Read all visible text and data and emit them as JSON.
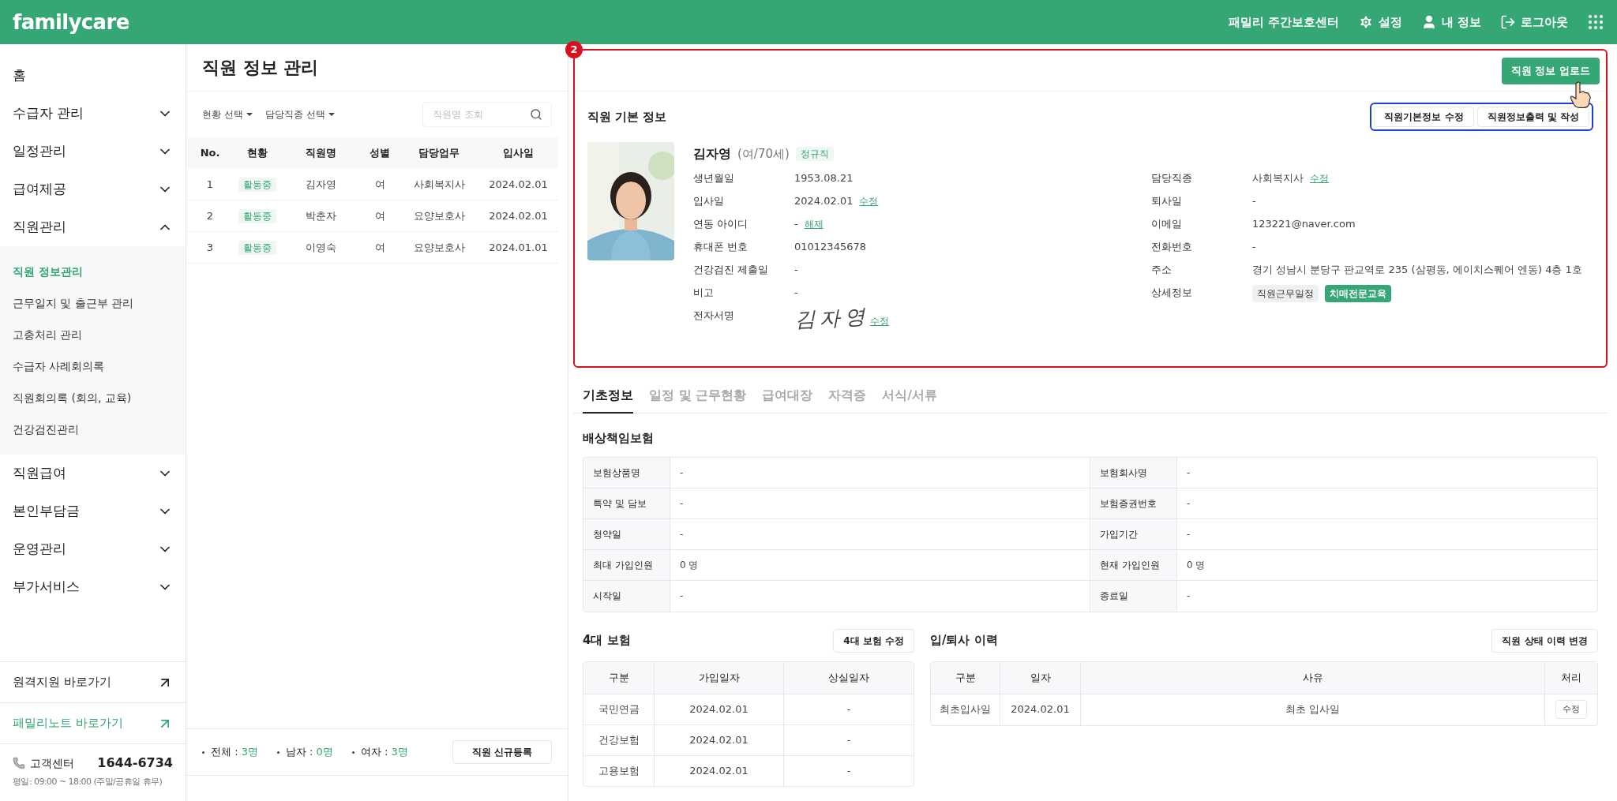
{
  "header": {
    "logo": "familycare",
    "center_name": "패밀리 주간보호센터",
    "links": [
      {
        "kind": "settings",
        "label": "설정"
      },
      {
        "kind": "profile",
        "label": "내 정보"
      },
      {
        "kind": "logout",
        "label": "로그아웃"
      }
    ]
  },
  "sidebar": {
    "items": [
      {
        "kind": "link",
        "label": "홈"
      },
      {
        "kind": "group",
        "label": "수급자 관리",
        "expanded": false
      },
      {
        "kind": "group",
        "label": "일정관리",
        "expanded": false
      },
      {
        "kind": "group",
        "label": "급여제공",
        "expanded": false
      },
      {
        "kind": "group",
        "label": "직원관리",
        "expanded": true,
        "children": [
          {
            "label": "직원 정보관리",
            "selected": true
          },
          {
            "label": "근무일지 및 출근부 관리",
            "selected": false
          },
          {
            "label": "고충처리 관리",
            "selected": false
          },
          {
            "label": "수급자 사례회의록",
            "selected": false
          },
          {
            "label": "직원회의록 (회의, 교육)",
            "selected": false
          },
          {
            "label": "건강검진관리",
            "selected": false
          }
        ]
      },
      {
        "kind": "group",
        "label": "직원급여",
        "expanded": false
      },
      {
        "kind": "group",
        "label": "본인부담금",
        "expanded": false
      },
      {
        "kind": "group",
        "label": "운영관리",
        "expanded": false
      },
      {
        "kind": "group",
        "label": "부가서비스",
        "expanded": false
      }
    ],
    "shortcuts": [
      {
        "label": "원격지원 바로가기",
        "highlight": false
      },
      {
        "label": "패밀리노트 바로가기",
        "highlight": true
      }
    ],
    "support": {
      "label": "고객센터",
      "phone": "1644-6734",
      "hours": "평일: 09:00 ~ 18:00 (주말/공휴일 휴무)"
    }
  },
  "staff_list": {
    "title": "직원 정보 관리",
    "filters": [
      "현황 선택",
      "담당직종 선택"
    ],
    "search": {
      "placeholder": "직원명 조회"
    },
    "columns": [
      "No.",
      "현황",
      "직원명",
      "성별",
      "담당업무",
      "입사일"
    ],
    "rows": [
      [
        "1",
        "활동중",
        "김자영",
        "여",
        "사회복지사",
        "2024.02.01"
      ],
      [
        "2",
        "활동중",
        "박춘자",
        "여",
        "요양보호사",
        "2024.02.01"
      ],
      [
        "3",
        "활동중",
        "이영숙",
        "여",
        "요양보호사",
        "2024.01.01"
      ]
    ],
    "stats": [
      {
        "label": "전체 :",
        "value": "3명"
      },
      {
        "label": "남자 :",
        "value": "0명"
      },
      {
        "label": "여자 :",
        "value": "3명"
      }
    ],
    "register_button": "직원 신규등록"
  },
  "annotation": {
    "badge": "2"
  },
  "detail": {
    "upload_button": "직원 정보 업로드",
    "section_title": "직원 기본 정보",
    "action_buttons": [
      "직원기본정보 수정",
      "직원정보출력 및 작성"
    ],
    "profile": {
      "name": "김자영",
      "meta": "(여/70세)",
      "employment": "정규직"
    },
    "left_fields": [
      {
        "kind": "text",
        "label": "생년월일",
        "value": "1953.08.21"
      },
      {
        "kind": "text",
        "label": "입사일",
        "value": "2024.02.01",
        "link": "수정"
      },
      {
        "kind": "text",
        "label": "연동 아이디",
        "value": "-",
        "link": "해제"
      },
      {
        "kind": "text",
        "label": "휴대폰 번호",
        "value": "01012345678"
      },
      {
        "kind": "text",
        "label": "건강검진 제출일",
        "value": "-"
      },
      {
        "kind": "text",
        "label": "비고",
        "value": "-"
      },
      {
        "kind": "signature",
        "label": "전자서명",
        "value": "김자영",
        "link": "수정"
      }
    ],
    "right_fields": [
      {
        "kind": "text",
        "label": "담당직종",
        "value": "사회복지사",
        "link": "수정"
      },
      {
        "kind": "text",
        "label": "퇴사일",
        "value": "-"
      },
      {
        "kind": "text",
        "label": "이메일",
        "value": "123221@naver.com"
      },
      {
        "kind": "text",
        "label": "전화번호",
        "value": "-"
      },
      {
        "kind": "text",
        "label": "주소",
        "value": "경기 성남시 분당구 판교역로 235 (삼평동, 에이치스퀘어 엔동) 4층 1호"
      },
      {
        "kind": "tags",
        "label": "상세정보",
        "tags": [
          {
            "label": "직원근무일정",
            "highlight": false
          },
          {
            "label": "치매전문교육",
            "highlight": true
          }
        ]
      }
    ]
  },
  "tabs": [
    {
      "label": "기초정보",
      "selected": true
    },
    {
      "label": "일정 및 근무현황",
      "selected": false
    },
    {
      "label": "급여대장",
      "selected": false
    },
    {
      "label": "자격증",
      "selected": false
    },
    {
      "label": "서식/서류",
      "selected": false
    }
  ],
  "liability": {
    "title": "배상책임보험",
    "rows": [
      [
        "보험상품명",
        "-",
        "보험회사명",
        "-"
      ],
      [
        "특약 및 담보",
        "-",
        "보험증권번호",
        "-"
      ],
      [
        "청약일",
        "-",
        "가입기간",
        "-"
      ],
      [
        "최대 가입인원",
        "0 명",
        "현재 가입인원",
        "0 명"
      ],
      [
        "시작일",
        "-",
        "종료일",
        "-"
      ]
    ]
  },
  "four_insurance": {
    "title": "4대 보험",
    "button": "4대 보험 수정",
    "columns": [
      "구분",
      "가입일자",
      "상실일자"
    ],
    "rows": [
      [
        "국민연금",
        "2024.02.01",
        "-"
      ],
      [
        "건강보험",
        "2024.02.01",
        "-"
      ],
      [
        "고용보험",
        "2024.02.01",
        "-"
      ]
    ]
  },
  "history": {
    "title": "입/퇴사 이력",
    "button": "직원 상태 이력 변경",
    "columns": [
      "구분",
      "일자",
      "사유",
      "처리"
    ],
    "rows": [
      {
        "type": "최초입사일",
        "date": "2024.02.01",
        "reason": "최초 입사일",
        "action": "수정"
      }
    ]
  }
}
